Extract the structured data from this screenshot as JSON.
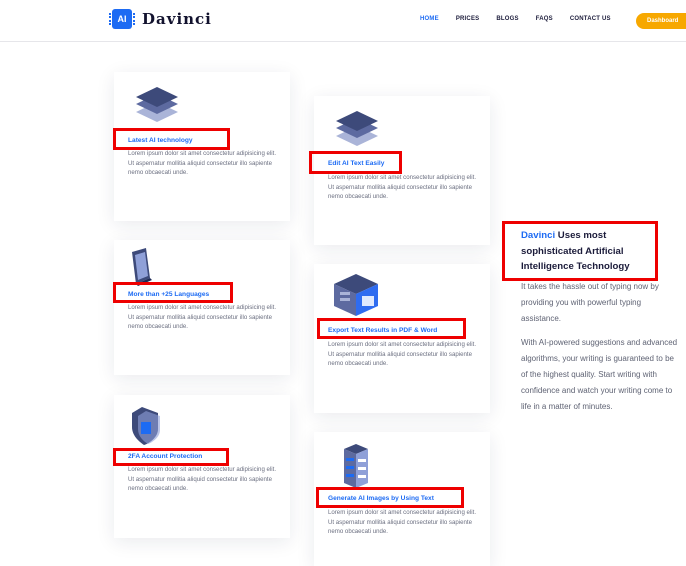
{
  "header": {
    "logo_chip": "AI",
    "logo_text": "Davinci",
    "nav": [
      "HOME",
      "PRICES",
      "BLOGS",
      "FAQS",
      "CONTACT US"
    ],
    "dashboard_label": "Dashboard"
  },
  "cards": [
    {
      "title": "Latest AI technology",
      "icon": "layers-icon"
    },
    {
      "title": "Edit AI Text Easily",
      "icon": "layers-icon"
    },
    {
      "title": "More than +25 Languages",
      "icon": "phone-icon"
    },
    {
      "title": "Export Text Results in PDF & Word",
      "icon": "server-icon"
    },
    {
      "title": "2FA Account Protection",
      "icon": "shield-icon"
    },
    {
      "title": "Generate AI Images by Using Text",
      "icon": "database-icon"
    }
  ],
  "card_desc": "Lorem ipsum dolor sit amet consectetur adipisicing elit. Ut aspernatur mollitia aliquid consectetur illo sapiente nemo obcaecati unde.",
  "side": {
    "brand": "Davinci",
    "heading_rest": " Uses most sophisticated Artificial Intelligence Technology",
    "p1": "It takes the hassle out of typing now by providing you with powerful typing assistance.",
    "p2": "With AI-powered suggestions and advanced algorithms, your writing is guaranteed to be of the highest quality. Start writing with confidence and watch your writing come to life in a matter of minutes."
  },
  "colors": {
    "accent": "#1d6bf3",
    "cta": "#f7a800",
    "highlight": "#ee0000",
    "icon_dark": "#3d4a7a"
  }
}
